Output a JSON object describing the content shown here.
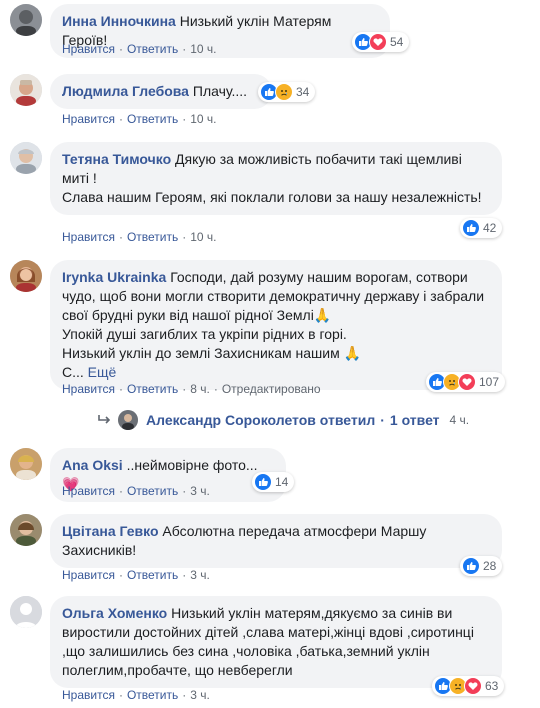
{
  "actions": {
    "like": "Нравится",
    "reply": "Ответить",
    "sep": "·"
  },
  "comments": [
    {
      "author": "Инна Инночкина",
      "text": "Низький уклін Матерям Героїв!",
      "time": "10 ч.",
      "reactions": [
        "like",
        "love"
      ],
      "count": "54"
    },
    {
      "author": "Людмила Глебова",
      "text": "Плачу....",
      "time": "10 ч.",
      "reactions": [
        "like",
        "sad"
      ],
      "count": "34"
    },
    {
      "author": "Тетяна Тимочко",
      "text": "Дякую за можливість побачити такі щемливі миті !",
      "text2": "Слава нашим Героям, які поклали голови за нашу незалежність!",
      "time": "10 ч.",
      "reactions": [
        "like"
      ],
      "count": "42"
    },
    {
      "author": "Irynka Ukrainka",
      "text": "Господи, дай розуму нашим ворогам, сотвори чудо, щоб вони могли створити демократичну державу і забрали свої брудні руки від нашої рідної Землі🙏",
      "text2": "Упокій душі загиблих та укріпи рідних в горі.",
      "text3": "Низький уклін до землі Захисникам нашим 🙏",
      "text4": "С...",
      "more": "Ещё",
      "time": "8 ч.",
      "edited": "Отредактировано",
      "reactions": [
        "like",
        "sad",
        "love"
      ],
      "count": "107"
    },
    {
      "author": "Ana Oksi",
      "text": "..неймовірне фото...💗",
      "time": "3 ч.",
      "reactions": [
        "like"
      ],
      "count": "14"
    },
    {
      "author": "Цвітана Гевко",
      "text": "Абсолютна передача атмосфери Маршу Захисників!",
      "time": "3 ч.",
      "reactions": [
        "like"
      ],
      "count": "28"
    },
    {
      "author": "Ольга Хоменко",
      "text": "Низький уклін матерям,дякуємо за синів ви виростили достойних дітей ,слава матері,жінці вдові ,сиротинці ,що залишились без сина ,чоловіка ,батька,земний уклін полеглим,пробачте, що невберегли",
      "time": "3 ч.",
      "reactions": [
        "like",
        "sad",
        "love"
      ],
      "count": "63"
    }
  ],
  "reply_thread": {
    "author": "Александр Сороколетов",
    "verb": "ответил",
    "sep": "·",
    "count_text": "1 ответ",
    "time": "4 ч."
  }
}
